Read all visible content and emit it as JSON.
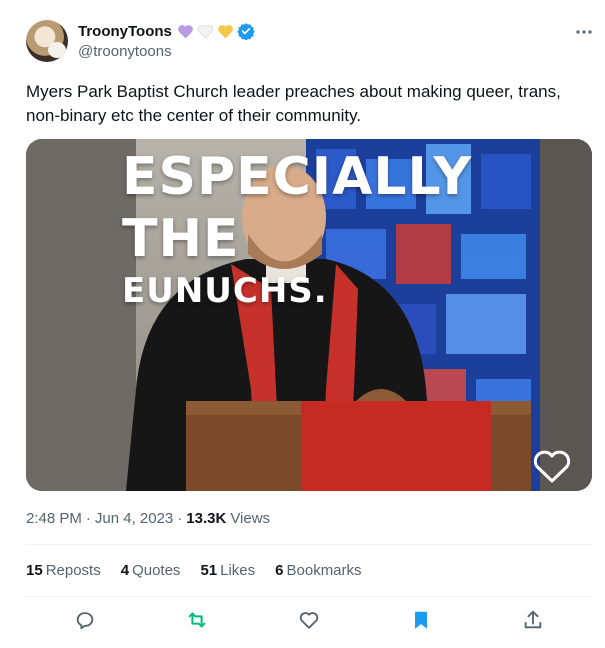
{
  "author": {
    "display_name": "TroonyToons",
    "handle": "@troonytoons",
    "badges": [
      "purple-heart-icon",
      "white-heart-icon",
      "yellow-heart-icon",
      "verified-badge-icon"
    ]
  },
  "tweet": {
    "text": "Myers Park Baptist Church leader preaches about making queer, trans, non-binary etc the center of their community."
  },
  "media": {
    "caption_lines": [
      "ESPECIALLY",
      "THE",
      "EUNUCHS."
    ]
  },
  "meta": {
    "time": "2:48 PM",
    "separator": "·",
    "date": "Jun 4, 2023",
    "views_count": "13.3K",
    "views_label": "Views"
  },
  "stats": {
    "reposts": {
      "count": "15",
      "label": "Reposts"
    },
    "quotes": {
      "count": "4",
      "label": "Quotes"
    },
    "likes": {
      "count": "51",
      "label": "Likes"
    },
    "bookmarks": {
      "count": "6",
      "label": "Bookmarks"
    }
  },
  "colors": {
    "text_primary": "#0f1419",
    "text_secondary": "#536471",
    "verified_blue": "#1d9bf0",
    "repost_green": "#00ba7c",
    "bookmark_blue": "#1d9bf0"
  }
}
